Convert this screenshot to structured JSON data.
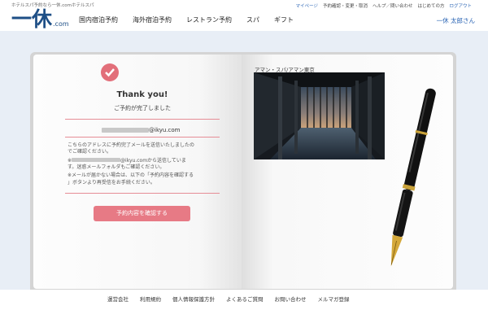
{
  "header": {
    "tagline": "ホテルスパ予約なら一休.comホテルスパ",
    "logo_mark": "一休",
    "logo_suffix": ".com",
    "util_links": [
      "マイページ",
      "予約確認・変更・取消",
      "ヘルプ／問い合わせ",
      "はじめての方",
      "ログアウト"
    ],
    "main_nav": [
      "国内宿泊予約",
      "海外宿泊予約",
      "レストラン予約",
      "スパ",
      "ギフト"
    ],
    "user_name": "一休 太郎さん"
  },
  "confirmation": {
    "title": "Thank you!",
    "subtitle": "ご予約が完了しました",
    "email_domain": "@ikyu.com",
    "message_1a": "こちらのアドレスに予約完了メールを送信いたしましたの",
    "message_1b": "でご確認ください。",
    "message_2a_suffix": "@ikyu.comから送信していま",
    "message_2b": "す。迷惑メールフォルダもご確認ください。",
    "message_3a": "※メールが届かない場合は、以下の「予約内容を確認する",
    "message_3b": "」ボタンより再受信をお手続ください。",
    "button_label": "予約内容を確認する"
  },
  "facility": {
    "caption": "アマン・スパ/アマン東京"
  },
  "footer": {
    "links": [
      "運営会社",
      "利用規約",
      "個人情報保護方針",
      "よくあるご質問",
      "お問い合わせ",
      "メルマガ登録"
    ]
  },
  "colors": {
    "accent_pink": "#e77a85",
    "brand_blue": "#1e4f86",
    "link_blue": "#2a64b4",
    "stage_bg": "#e8eef6"
  }
}
